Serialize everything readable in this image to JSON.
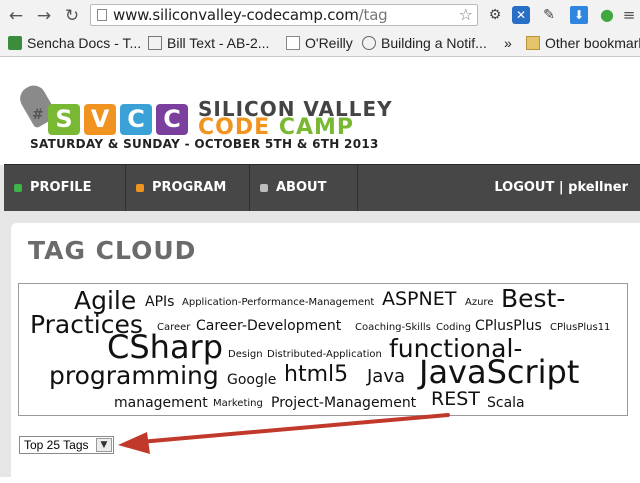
{
  "browser": {
    "url_host": "www.siliconvalley-codecamp.com",
    "url_path": "/tag",
    "bookmarks": [
      {
        "label": "Sencha Docs - T..."
      },
      {
        "label": "Bill Text - AB-2..."
      },
      {
        "label": "O'Reilly"
      },
      {
        "label": "Building a Notif..."
      },
      {
        "label": "»"
      },
      {
        "label": "Other bookmarks"
      }
    ]
  },
  "site": {
    "logo_letters": [
      "S",
      "V",
      "C",
      "C"
    ],
    "logo_hash": "#",
    "logo_line1": "SILICON VALLEY",
    "logo_code": "CODE",
    "logo_camp": "CAMP",
    "logo_date": "SATURDAY & SUNDAY - OCTOBER 5TH & 6TH 2013",
    "brand_colors": {
      "s": "#79b832",
      "v": "#f0941f",
      "c1": "#3aa2d6",
      "c2": "#7b3f9e"
    }
  },
  "nav": {
    "items": [
      {
        "label": "PROFILE",
        "color": "#3fb24a"
      },
      {
        "label": "PROGRAM",
        "color": "#f0941f"
      },
      {
        "label": "ABOUT",
        "color": "#bdbdbd"
      }
    ],
    "logout": "LOGOUT",
    "separator": "|",
    "username": "pkellner"
  },
  "main": {
    "title": "TAG CLOUD",
    "tags": [
      "Agile",
      "APIs",
      "Application-Performance-Management",
      "ASPNET",
      "Azure",
      "Best-",
      "Practices",
      "Career",
      "Career-Development",
      "Coaching-Skills",
      "Coding",
      "CPlusPlus",
      "CPlusPlus11",
      "CSharp",
      "Design",
      "Distributed-Application",
      "functional-",
      "programming",
      "Google",
      "html5",
      "Java",
      "JavaScript",
      "management",
      "Marketing",
      "Project-Management",
      "REST",
      "Scala"
    ],
    "select_value": "Top 25 Tags",
    "annotation_color": "#c0392b"
  }
}
